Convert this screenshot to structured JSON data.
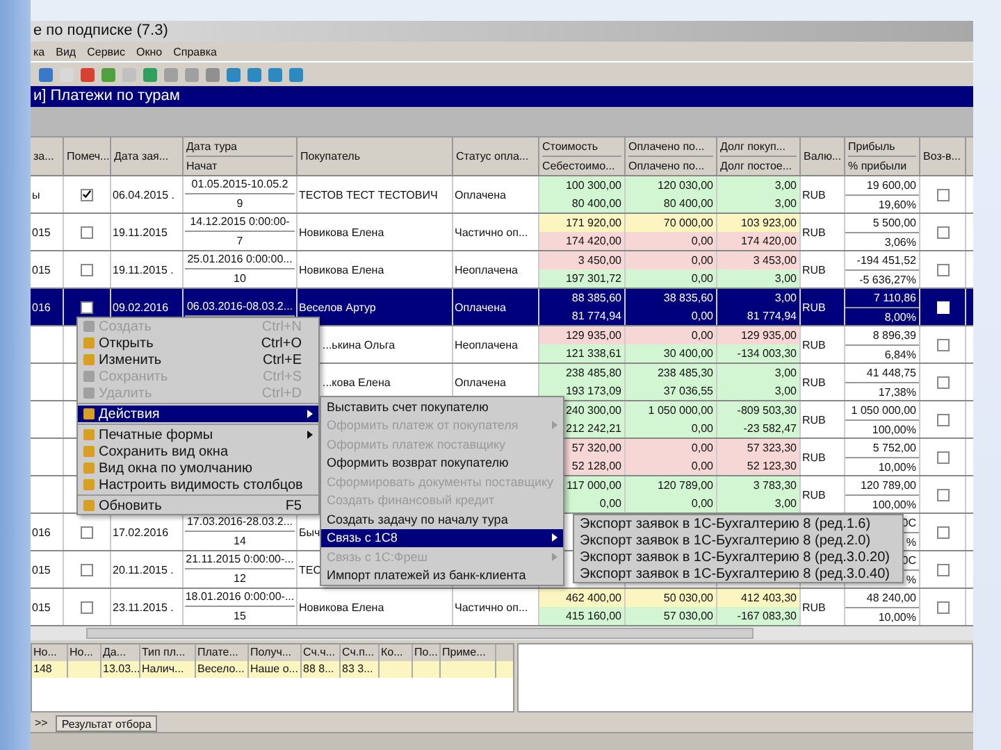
{
  "window": {
    "title": "е по подписке (7.3)"
  },
  "menu_bar": [
    "ка",
    "Вид",
    "Сервис",
    "Окно",
    "Справка"
  ],
  "document_title": "и] Платежи по турам",
  "table": {
    "columns": [
      {
        "label": "за..."
      },
      {
        "label": "Помеч..."
      },
      {
        "label": "Дата зая..."
      },
      {
        "label": "Дата тура",
        "sublabel": "Начат"
      },
      {
        "label": "Покупатель"
      },
      {
        "label": "Статус опла..."
      },
      {
        "label": "Стоимость",
        "sublabel": "Себестоимо..."
      },
      {
        "label": "Оплачено по...",
        "sublabel": "Оплачено по..."
      },
      {
        "label": "Долг покуп...",
        "sublabel": "Долг постое..."
      },
      {
        "label": "Валю..."
      },
      {
        "label": "Прибыль",
        "sublabel": "% прибыли"
      },
      {
        "label": "Воз-в..."
      }
    ],
    "rows": [
      {
        "lead": "ы",
        "marked": true,
        "order_date": "06.04.2015 .",
        "tour_dates": "01.05.2015-10.05.2",
        "tour_days": "9",
        "buyer": "ТЕСТОВ ТЕСТ ТЕСТОВИЧ",
        "status": "Оплачена",
        "lines": [
          {
            "cost": "100 300,00",
            "paid": "120 030,00",
            "debt": "3,00",
            "color": "#d2f5d2"
          },
          {
            "cost": "80 400,00",
            "paid": "80 400,00",
            "debt": "3,00",
            "color": "#d2f5d2"
          }
        ],
        "currency": "RUB",
        "profit": "19 600,00",
        "profit_pct": "19,60%",
        "returned": false,
        "selected": false
      },
      {
        "lead": "015",
        "marked": false,
        "order_date": "19.11.2015",
        "tour_dates": "14.12.2015 0:00:00-",
        "tour_days": "7",
        "buyer": "Новикова Елена",
        "status": "Частично оп...",
        "lines": [
          {
            "cost": "171 920,00",
            "paid": "70 000,00",
            "debt": "103 923,00",
            "color": "#fbf5c0"
          },
          {
            "cost": "174 420,00",
            "paid": "0,00",
            "debt": "174 420,00",
            "color": "#f7d6d6"
          }
        ],
        "currency": "RUB",
        "profit": "5 500,00",
        "profit_pct": "3,06%",
        "returned": false,
        "selected": false
      },
      {
        "lead": "015",
        "marked": false,
        "order_date": "19.11.2015 .",
        "tour_dates": "25.01.2016 0:00:00...",
        "tour_days": "10",
        "buyer": "Новикова Елена",
        "status": "Неоплачена",
        "lines": [
          {
            "cost": "3 450,00",
            "paid": "0,00",
            "debt": "3 453,00",
            "color": "#f7d6d6"
          },
          {
            "cost": "197 301,72",
            "paid": "0,00",
            "debt": "3,00",
            "color": "#d2f5d2"
          }
        ],
        "currency": "RUB",
        "profit": "-194 451,52",
        "profit_pct": "-5 636,27%",
        "returned": false,
        "selected": false
      },
      {
        "lead": "016",
        "marked": false,
        "order_date": "09.02.2016",
        "tour_dates": "06.03.2016-08.03.2...",
        "buyer": "Веселов Артур",
        "status": "Оплачена",
        "lines": [
          {
            "cost": "88 385,60",
            "paid": "38 835,60",
            "debt": "3,00"
          },
          {
            "cost": "81 774,94",
            "paid": "0,00",
            "debt": "81 774,94"
          }
        ],
        "currency": "RUB",
        "profit": "7 110,86",
        "profit_pct": "8,00%",
        "returned": false,
        "selected": true
      },
      {
        "buyer": "...ькина Ольга",
        "status": "Неоплачена",
        "lines": [
          {
            "cost": "129 935,00",
            "paid": "0,00",
            "debt": "129 935,00",
            "color": "#f7d6d6"
          },
          {
            "cost": "121 338,61",
            "paid": "30 400,00",
            "debt": "-134 003,30",
            "color": "#d2f5d2"
          }
        ],
        "currency": "RUB",
        "profit": "8 896,39",
        "profit_pct": "6,84%",
        "returned": false,
        "selected": false
      },
      {
        "buyer": "...кова Елена",
        "status": "Оплачена",
        "lines": [
          {
            "cost": "238 485,80",
            "paid": "238 485,30",
            "debt": "3,00",
            "color": "#d2f5d2"
          },
          {
            "cost": "193 173,09",
            "paid": "37 036,55",
            "debt": "3,00",
            "color": "#d2f5d2"
          }
        ],
        "currency": "RUB",
        "profit": "41 448,75",
        "profit_pct": "17,38%",
        "returned": false,
        "selected": false
      },
      {
        "lines": [
          {
            "cost": "240 300,00",
            "paid": "1 050 000,00",
            "debt": "-809 503,30",
            "color": "#d2f5d2"
          },
          {
            "cost": "212 242,21",
            "paid": "0,00",
            "debt": "-23 582,47",
            "color": "#d2f5d2"
          }
        ],
        "currency": "RUB",
        "profit": "1 050 000,00",
        "profit_pct": "100,00%",
        "returned": false,
        "selected": false
      },
      {
        "lines": [
          {
            "cost": "57 320,00",
            "paid": "0,00",
            "debt": "57 323,30",
            "color": "#f7d6d6"
          },
          {
            "cost": "52 128,00",
            "paid": "0,00",
            "debt": "52 123,30",
            "color": "#f7d6d6"
          }
        ],
        "currency": "RUB",
        "profit": "5 752,00",
        "profit_pct": "10,00%",
        "returned": false,
        "selected": false
      },
      {
        "lines": [
          {
            "cost": "117 000,00",
            "paid": "120 789,00",
            "debt": "3 783,30",
            "color": "#d2f5d2"
          },
          {
            "cost": "0,00",
            "paid": "0,00",
            "debt": "3,00",
            "color": "#d2f5d2"
          }
        ],
        "currency": "RUB",
        "profit": "120 789,00",
        "profit_pct": "100,00%",
        "returned": false,
        "selected": false
      },
      {
        "lead": "016",
        "marked": false,
        "order_date": "17.02.2016",
        "tour_dates": "17.03.2016-28.03.2...",
        "tour_days": "14",
        "buyer": "Быч",
        "profit": "0С",
        "profit_pct": "%",
        "returned": false,
        "selected": false
      },
      {
        "lead": "015",
        "marked": false,
        "order_date": "20.11.2015 .",
        "tour_dates": "21.11.2015 0:00:00-...",
        "tour_days": "12",
        "buyer": "ТЕС",
        "profit": "0С",
        "profit_pct": "%",
        "returned": false,
        "selected": false
      },
      {
        "lead": "015",
        "marked": false,
        "order_date": "23.11.2015 .",
        "tour_dates": "18.01.2016 0:00:00-...",
        "tour_days": "15",
        "buyer": "Новикова Елена",
        "status": "Частично оп...",
        "lines": [
          {
            "cost": "462 400,00",
            "paid": "50 030,00",
            "debt": "412 403,30",
            "color": "#fbf5c0"
          },
          {
            "cost": "415 160,00",
            "paid": "57 030,00",
            "debt": "-167 083,30",
            "color": "#d2f5d2"
          }
        ],
        "currency": "RUB",
        "profit": "48 240,00",
        "profit_pct": "10,00%",
        "returned": false,
        "selected": false
      }
    ]
  },
  "context_menu": [
    {
      "kind": "item",
      "label": "Создать",
      "shortcut": "Ctrl+N",
      "disabled": true,
      "selected": false,
      "submenu": false
    },
    {
      "kind": "item",
      "label": "Открыть",
      "shortcut": "Ctrl+O",
      "disabled": false,
      "selected": false,
      "submenu": false
    },
    {
      "kind": "item",
      "label": "Изменить",
      "shortcut": "Ctrl+E",
      "disabled": false,
      "selected": false,
      "submenu": false
    },
    {
      "kind": "item",
      "label": "Сохранить",
      "shortcut": "Ctrl+S",
      "disabled": true,
      "selected": false,
      "submenu": false
    },
    {
      "kind": "item",
      "label": "Удалить",
      "shortcut": "Ctrl+D",
      "disabled": true,
      "selected": false,
      "submenu": false
    },
    {
      "kind": "separator"
    },
    {
      "kind": "item",
      "label": "Действия",
      "disabled": false,
      "selected": true,
      "submenu": true
    },
    {
      "kind": "separator"
    },
    {
      "kind": "item",
      "label": "Печатные формы",
      "disabled": false,
      "selected": false,
      "submenu": true
    },
    {
      "kind": "item",
      "label": "Сохранить вид окна",
      "disabled": false,
      "selected": false,
      "submenu": false
    },
    {
      "kind": "item",
      "label": "Вид окна по умолчанию",
      "disabled": false,
      "selected": false,
      "submenu": false
    },
    {
      "kind": "item",
      "label": "Настроить видимость столбцов",
      "disabled": false,
      "selected": false,
      "submenu": false
    },
    {
      "kind": "separator"
    },
    {
      "kind": "item",
      "label": "Обновить",
      "shortcut": "F5",
      "disabled": false,
      "selected": false,
      "submenu": false
    }
  ],
  "actions_menu": [
    {
      "label": "Выставить счет покупателю",
      "disabled": false,
      "selected": false,
      "submenu": false
    },
    {
      "label": "Оформить платеж от покупателя",
      "disabled": true,
      "selected": false,
      "submenu": true
    },
    {
      "label": "Оформить платеж поставщику",
      "disabled": true,
      "selected": false,
      "submenu": false
    },
    {
      "label": "Оформить возврат покупателю",
      "disabled": false,
      "selected": false,
      "submenu": false
    },
    {
      "label": "Сформировать документы поставщику",
      "disabled": true,
      "selected": false,
      "submenu": false
    },
    {
      "label": "Создать финансовый кредит",
      "disabled": true,
      "selected": false,
      "submenu": false
    },
    {
      "label": "Создать задачу по началу тура",
      "disabled": false,
      "selected": false,
      "submenu": false
    },
    {
      "label": "Связь с 1С8",
      "disabled": false,
      "selected": true,
      "submenu": true
    },
    {
      "label": "Связь с 1С:Фреш",
      "disabled": true,
      "selected": false,
      "submenu": true
    },
    {
      "label": "Импорт платежей из банк-клиента",
      "disabled": false,
      "selected": false,
      "submenu": false
    }
  ],
  "export_menu": [
    "Экспорт заявок в 1С-Бухгалтерию 8 (ред.1.6)",
    "Экспорт заявок в 1С-Бухгалтерию 8 (ред.2.0)",
    "Экспорт заявок в 1С-Бухгалтерию 8 (ред.3.0.20)",
    "Экспорт заявок в 1С-Бухгалтерию 8 (ред.3.0.40)"
  ],
  "payments": {
    "columns": [
      "Но...",
      "Но...",
      "Да...",
      "Тип пл...",
      "Плате...",
      "Получ...",
      "Сч.ч...",
      "Сч.п...",
      "Ко...",
      "По...",
      "Приме..."
    ],
    "rows": [
      {
        "no": "148",
        "date": "13.03...",
        "type": "Налич...",
        "payer": "Весело...",
        "recipient": "Наше о...",
        "account_1": "88 8...",
        "account_2": "83 3...",
        "selected": true
      }
    ]
  },
  "tabs": [
    {
      "label": ">>",
      "selected": false
    },
    {
      "label": "Результат отбора",
      "selected": true
    }
  ]
}
